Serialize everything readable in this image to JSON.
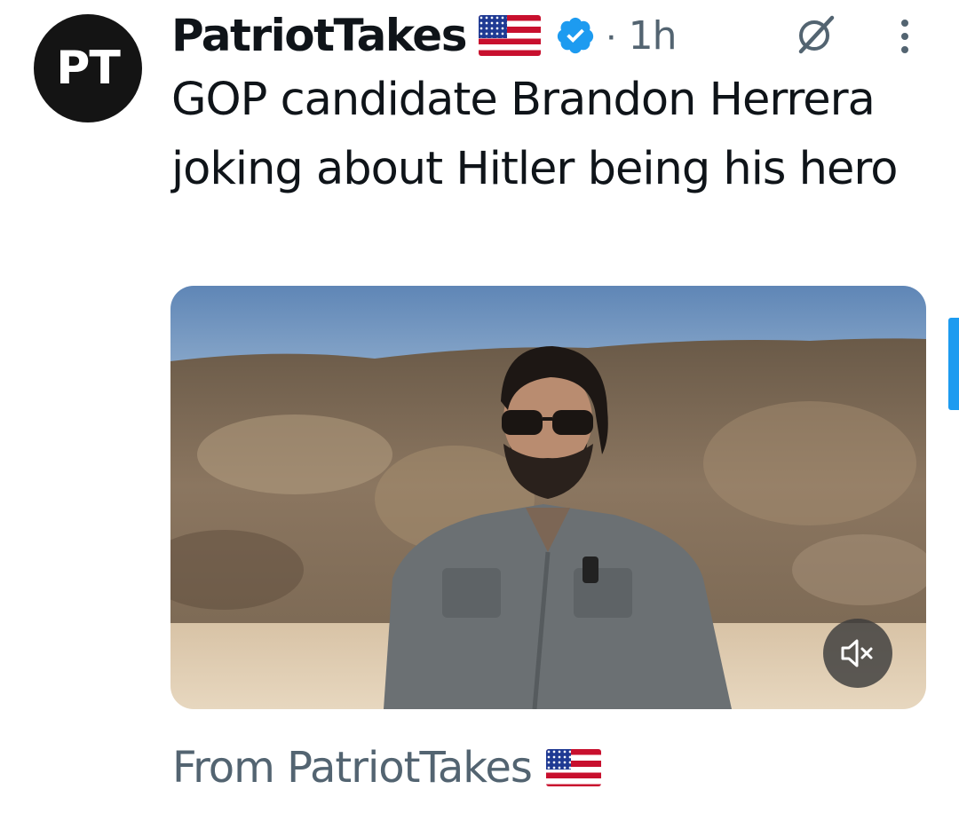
{
  "tweet": {
    "avatar_initials": "PT",
    "display_name": "PatriotTakes",
    "flag_icon": "us-flag-icon",
    "verified_icon": "verified-badge-icon",
    "separator": "·",
    "timestamp": "1h",
    "grok_icon": "grok-icon",
    "more_icon": "more-options-icon",
    "text": "GOP candidate Brandon Herrera joking about Hitler being his hero"
  },
  "media": {
    "type": "video",
    "mute_icon": "muted-speaker-icon"
  },
  "footer": {
    "from_text": "From PatriotTakes",
    "flag_icon": "us-flag-icon"
  },
  "colors": {
    "accent": "#1d9bf0",
    "text": "#0f1419",
    "secondary_text": "#536471",
    "avatar_bg": "#141414"
  }
}
